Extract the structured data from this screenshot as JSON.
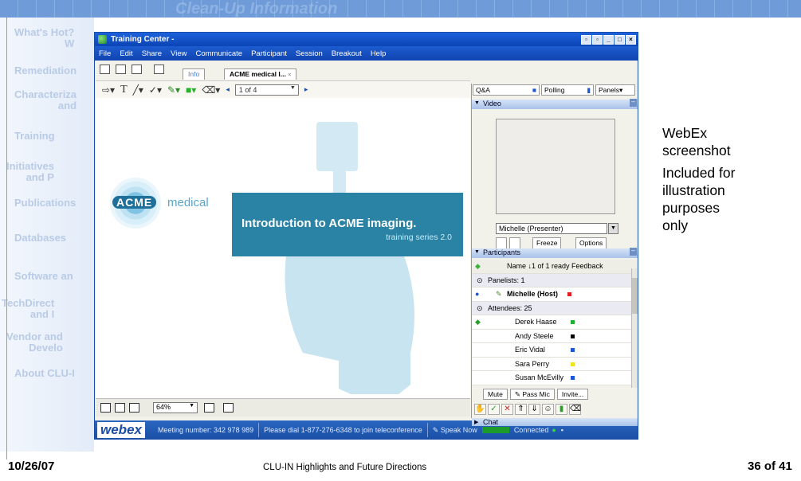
{
  "slide": {
    "heading": "Clean-Up Information",
    "nav": [
      {
        "l1": "What's Hot?",
        "l2": "W"
      },
      {
        "l1": "Remediation",
        "l2": ""
      },
      {
        "l1": "Characteriza",
        "l2": "and"
      },
      {
        "l1": "Training",
        "l2": ""
      },
      {
        "l1": "Initiatives",
        "l2": "and P"
      },
      {
        "l1": "Publications",
        "l2": ""
      },
      {
        "l1": "Databases",
        "l2": ""
      },
      {
        "l1": "Software an",
        "l2": ""
      },
      {
        "l1": "TechDirect",
        "l2": "and I"
      },
      {
        "l1": "Vendor and",
        "l2": "Develo"
      },
      {
        "l1": "About CLU-I",
        "l2": ""
      }
    ],
    "note1a": "WebEx",
    "note1b": "screenshot",
    "note2": [
      "Included for",
      "illustration",
      "purposes",
      "only"
    ],
    "footer_left": "10/26/07",
    "footer_center": "CLU-IN Highlights and Future Directions",
    "footer_right": "36 of 41"
  },
  "window": {
    "title": "Training Center -",
    "menu": [
      "File",
      "Edit",
      "Share",
      "View",
      "Communicate",
      "Participant",
      "Session",
      "Breakout",
      "Help"
    ],
    "tabs": {
      "info": "Info",
      "doc": "ACME medical I..."
    },
    "page_indicator": "1 of 4",
    "zoom": "64%",
    "slide_title": "Introduction to ACME imaging.",
    "slide_sub": "training series 2.0",
    "acme": "ACME",
    "medical": "medical",
    "status": {
      "logo_a": "web",
      "logo_b": "ex",
      "meeting": "Meeting number: 342 978 989",
      "dial": "Please dial 1-877-276-6348 to join teleconference",
      "speak": "Speak Now",
      "connected": "Connected"
    },
    "panel": {
      "qa": "Q&A",
      "polling": "Polling",
      "panels": "Panels",
      "video_head": "Video",
      "presenter_select": "Michelle (Presenter)",
      "freeze": "Freeze",
      "options": "Options",
      "participants_head": "Participants",
      "col_header": "Name ↓1 of 1 ready Feedback",
      "panelists": "Panelists: 1",
      "host": "Michelle (Host)",
      "attendees": "Attendees: 25",
      "people": [
        {
          "name": "Derek Haase",
          "color": "#22b032"
        },
        {
          "name": "Andy Steele",
          "color": "#000000"
        },
        {
          "name": "Eric Vidal",
          "color": "#1c55d8"
        },
        {
          "name": "Sara Perry",
          "color": "#f2e21a"
        },
        {
          "name": "Susan McEvilly",
          "color": "#1c55d8"
        }
      ],
      "mute": "Mute",
      "passmic": "Pass Mic",
      "invite": "Invite...",
      "chat_head": "Chat"
    }
  }
}
